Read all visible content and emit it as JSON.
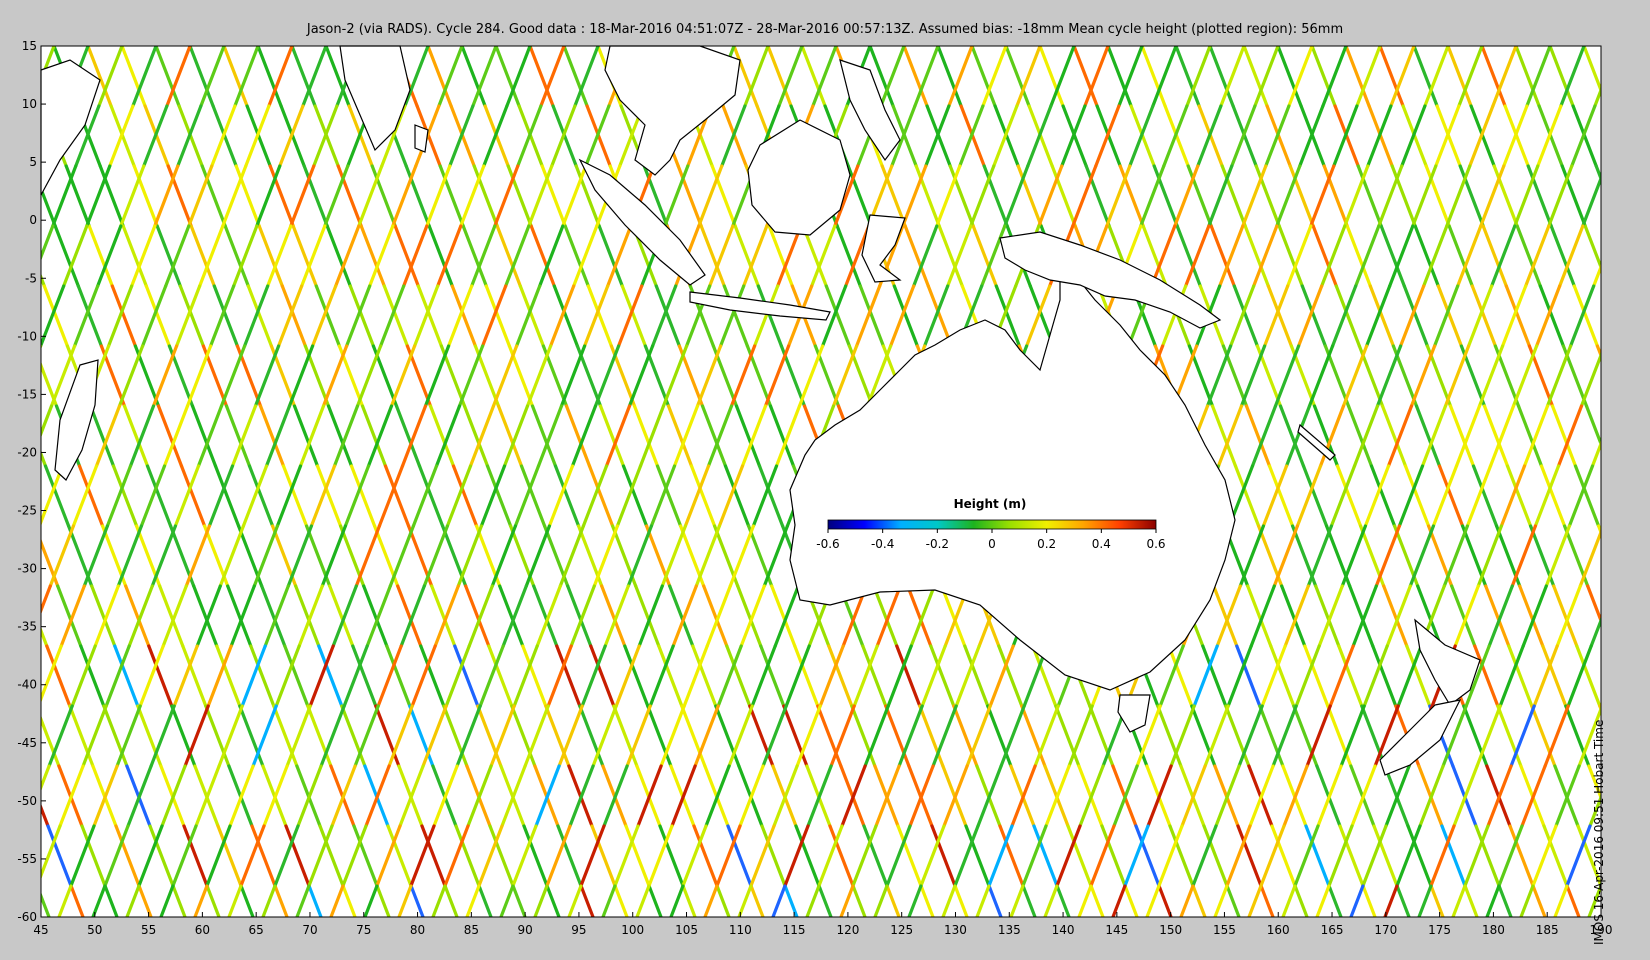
{
  "title": "Jason-2 (via RADS). Cycle 284. Good data : 18-Mar-2016 04:51:07Z - 28-Mar-2016 00:57:13Z. Assumed bias: -18mm  Mean cycle height (plotted region): 56mm",
  "credit": "IMOS 16-Apr-2016 09:51 Hobart Time",
  "map": {
    "lon_range": [
      45,
      190
    ],
    "lat_range": [
      -60,
      15
    ],
    "lon_ticks": [
      "45",
      "50",
      "55",
      "60",
      "65",
      "70",
      "75",
      "80",
      "85",
      "90",
      "95",
      "100",
      "105",
      "110",
      "115",
      "120",
      "125",
      "130",
      "135",
      "140",
      "145",
      "150",
      "155",
      "160",
      "165",
      "170",
      "175",
      "180",
      "185",
      "190"
    ],
    "lat_ticks": [
      "15",
      "10",
      "5",
      "0",
      "-5",
      "-10",
      "-15",
      "-20",
      "-25",
      "-30",
      "-35",
      "-40",
      "-45",
      "-50",
      "-55",
      "-60"
    ],
    "background": "#ffffff",
    "coastline_color": "#000000"
  },
  "colorbar": {
    "title": "Height (m)",
    "range": [
      -0.6,
      0.6
    ],
    "tick_labels": [
      "-0.6",
      "-0.4",
      "-0.2",
      "0",
      "0.2",
      "0.4",
      "0.6"
    ],
    "colors": [
      "#00007f",
      "#0000ff",
      "#00b0ff",
      "#00c8c8",
      "#1eb41e",
      "#9be000",
      "#f0f000",
      "#ffa500",
      "#ff4000",
      "#8b0000"
    ]
  }
}
